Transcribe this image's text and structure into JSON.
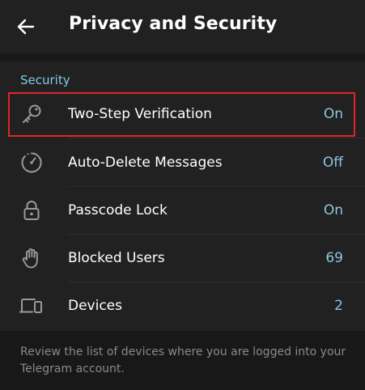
{
  "header": {
    "title": "Privacy and Security",
    "back_icon": "arrow-left-icon"
  },
  "security": {
    "header": "Security",
    "items": [
      {
        "label": "Two-Step Verification",
        "value": "On",
        "icon": "key-icon"
      },
      {
        "label": "Auto-Delete Messages",
        "value": "Off",
        "icon": "timer-icon"
      },
      {
        "label": "Passcode Lock",
        "value": "On",
        "icon": "lock-icon"
      },
      {
        "label": "Blocked Users",
        "value": "69",
        "icon": "hand-icon"
      },
      {
        "label": "Devices",
        "value": "2",
        "icon": "devices-icon"
      }
    ],
    "footer": "Review the list of devices where you are logged into your Telegram account."
  },
  "colors": {
    "accent": "#82c9e8",
    "highlight": "#e0252b",
    "background": "#181818",
    "surface": "#212121"
  }
}
